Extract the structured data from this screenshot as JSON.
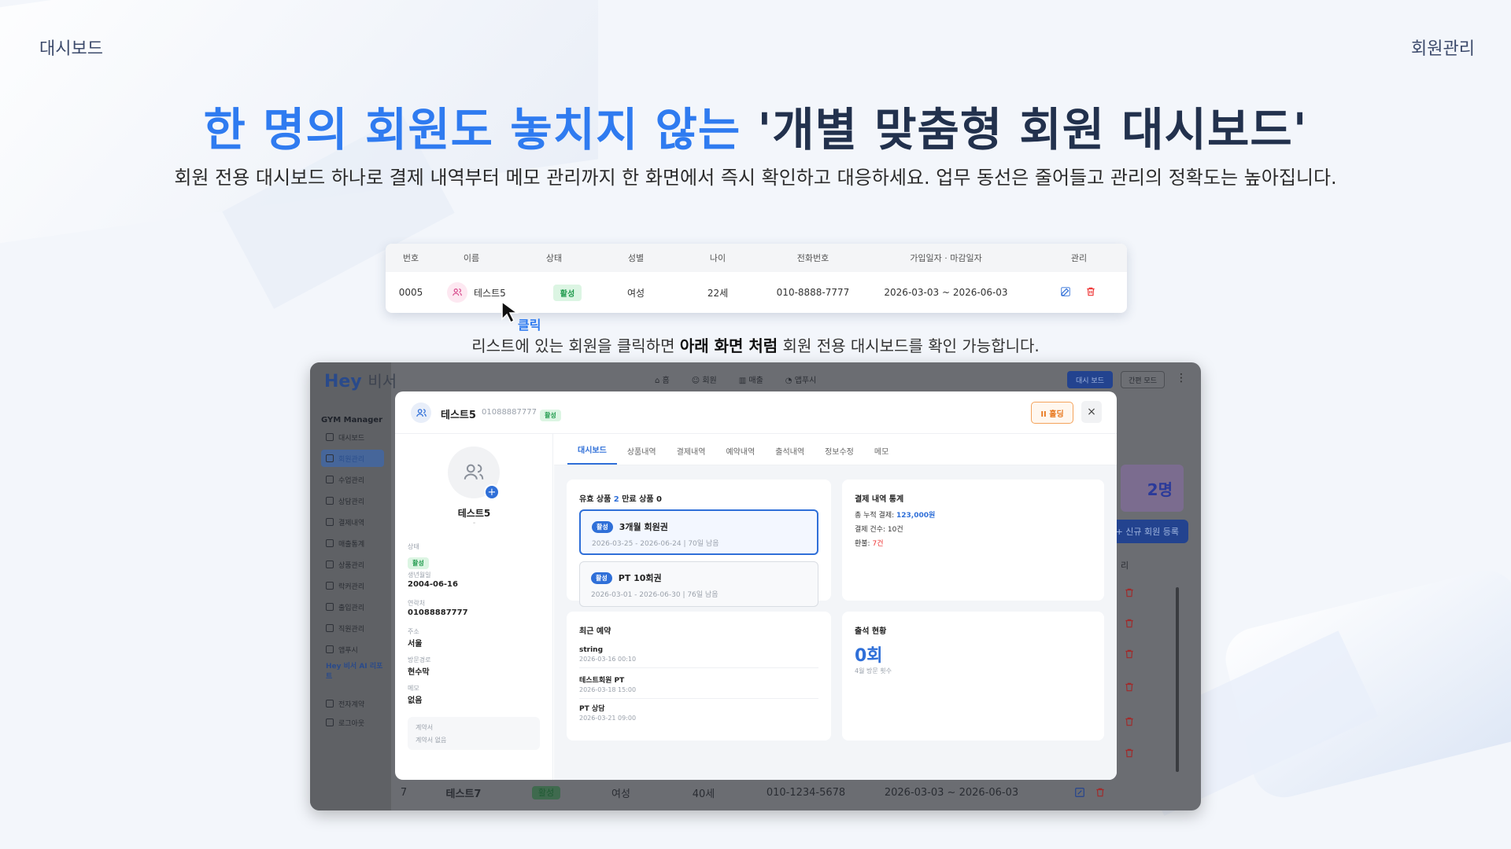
{
  "page": {
    "top_left": "대시보드",
    "top_right": "회원관리",
    "headline_blue": "한 명의 회원도 놓치지 않는",
    "headline_dark": "'개별 맞춤형 회원 대시보드'",
    "subline": "회원 전용 대시보드 하나로 결제 내역부터 메모 관리까지 한 화면에서 즉시 확인하고 대응하세요. 업무 동선은 줄어들고 관리의 정확도는 높아집니다.",
    "click_label": "클릭",
    "caption_pre": "리스트에 있는 회원을 클릭하면 ",
    "caption_bold": "아래 화면 처럼",
    "caption_post": " 회원 전용 대시보드를 확인 가능합니다."
  },
  "member_row": {
    "headers": [
      "번호",
      "이름",
      "상태",
      "성별",
      "나이",
      "전화번호",
      "가입일자 · 마감일자",
      "관리"
    ],
    "cells": {
      "no": "0005",
      "name": "테스트5",
      "status": "활성",
      "gender": "여성",
      "age": "22세",
      "phone": "010-8888-7777",
      "period": "2026-03-03 ~ 2026-06-03"
    }
  },
  "app": {
    "logo_main": "Hey",
    "logo_sub": "비서",
    "sidebar_title": "GYM Manager",
    "sidebar_items": [
      "대시보드",
      "회원관리",
      "수업관리",
      "상담관리",
      "결제내역",
      "매출통계",
      "상품관리",
      "락커관리",
      "출입관리",
      "직원관리",
      "앱푸시",
      "Hey 비서 AI 리포트",
      "전자계약",
      "로그아웃"
    ],
    "topnav": [
      "홈",
      "회원",
      "매출",
      "앱푸시"
    ],
    "btn_dashboard_mode": "대시 보드",
    "btn_simple_mode": "간편 모드",
    "count_value": "2명",
    "new_member_btn": "+ 신규 회원 등록",
    "col_partial": "리",
    "bg_last_row": {
      "no": "7",
      "name": "테스트7",
      "status": "활성",
      "gender": "여성",
      "age": "40세",
      "phone": "010-1234-5678",
      "period": "2026-03-03 ~ 2026-06-03"
    }
  },
  "modal": {
    "name": "테스트5",
    "phone": "01088887777",
    "status": "활성",
    "hold_btn": "II 홀딩",
    "close": "×",
    "left": {
      "name": "테스트5",
      "dash": "-",
      "fields": [
        {
          "label": "상태",
          "value": "활성"
        },
        {
          "label": "생년월일",
          "value": "2004-06-16"
        },
        {
          "label": "연락처",
          "value": "01088887777"
        },
        {
          "label": "주소",
          "value": "서울"
        },
        {
          "label": "방문경로",
          "value": "현수막"
        },
        {
          "label": "메모",
          "value": "없음"
        }
      ],
      "contract_label": "계약서",
      "contract_value": "계약서 없음"
    },
    "tabs": [
      "대시보드",
      "상품내역",
      "결제내역",
      "예약내역",
      "출석내역",
      "정보수정",
      "메모"
    ],
    "products": {
      "title_paid": "유효 상품",
      "paid_count": "2",
      "title_expired": "만료 상품",
      "expired_count": "0",
      "items": [
        {
          "badge": "활성",
          "name": "3개월 회원권",
          "dates": "2026-03-25 - 2026-06-24  | 70일 남음"
        },
        {
          "badge": "활성",
          "name": "PT 10회권",
          "dates": "2026-03-01 - 2026-06-30  | 76일 남음"
        }
      ]
    },
    "payment": {
      "title": "결제 내역 통계",
      "total_label": "총 누적 결제: ",
      "total_value": "123,000원",
      "count_line": "결제 건수: 10건",
      "refund_label": "환불: ",
      "refund_value": "7건"
    },
    "reservations": {
      "title": "최근 예약",
      "items": [
        {
          "name": "string",
          "date": "2026-03-16 00:10"
        },
        {
          "name": "테스트회원 PT",
          "date": "2026-03-18 15:00"
        },
        {
          "name": "PT 상담",
          "date": "2026-03-21 09:00"
        }
      ]
    },
    "attendance": {
      "title": "출석 현황",
      "value": "0회",
      "sub": "4월 방문 횟수"
    }
  }
}
